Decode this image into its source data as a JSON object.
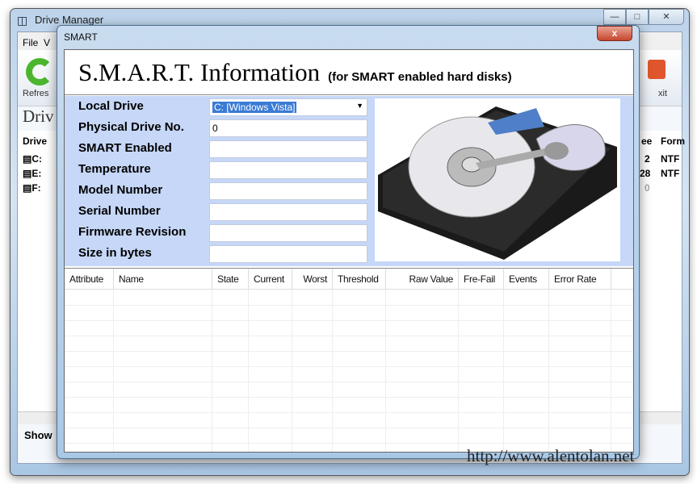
{
  "main_window": {
    "title": "Drive Manager",
    "menu": [
      "File",
      "V"
    ],
    "toolbar": {
      "refresh_label": "Refres",
      "exit_label": "xit"
    },
    "heading": "Driv",
    "list": {
      "headers": [
        "Drive",
        "ee",
        "Form"
      ],
      "rows": [
        {
          "drive": "C:",
          "free": "2",
          "format": "NTF"
        },
        {
          "drive": "E:",
          "free": "28",
          "format": "NTF"
        },
        {
          "drive": "F:",
          "free": "0",
          "format": ""
        }
      ]
    },
    "show_label": "Show",
    "url": "http://www.alentolan.net"
  },
  "dialog": {
    "title": "SMART",
    "close": "x",
    "heading": "S.M.A.R.T. Information",
    "subheading": "(for SMART enabled hard disks)",
    "fields": [
      {
        "label": "Local Drive",
        "value": "C: [Windows Vista]"
      },
      {
        "label": "Physical Drive No.",
        "value": "0"
      },
      {
        "label": "SMART Enabled",
        "value": ""
      },
      {
        "label": "Temperature",
        "value": ""
      },
      {
        "label": "Model Number",
        "value": ""
      },
      {
        "label": "Serial Number",
        "value": ""
      },
      {
        "label": "Firmware Revision",
        "value": ""
      },
      {
        "label": "Size in bytes",
        "value": ""
      }
    ],
    "table": {
      "columns": [
        "Attribute",
        "Name",
        "State",
        "Current",
        "Worst",
        "Threshold",
        "Raw Value",
        "Fre-Fail",
        "Events",
        "Error Rate"
      ],
      "rows": []
    }
  }
}
